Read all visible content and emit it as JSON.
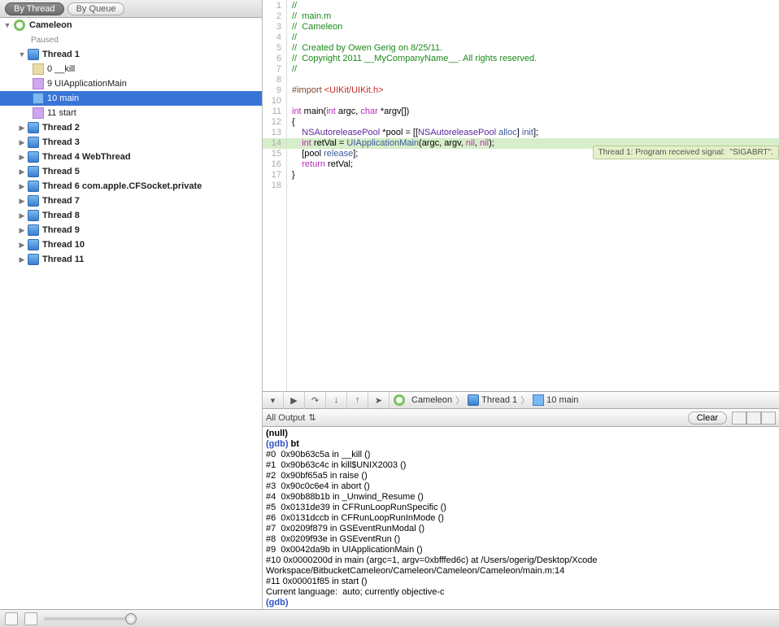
{
  "tabs": {
    "byThread": "By Thread",
    "byQueue": "By Queue"
  },
  "process": {
    "name": "Cameleon",
    "state": "Paused"
  },
  "threads": [
    {
      "label": "Thread 1",
      "open": true,
      "frames": [
        {
          "n": "0",
          "name": "__kill",
          "kind": "kill"
        },
        {
          "n": "9",
          "name": "UIApplicationMain",
          "kind": "lib"
        },
        {
          "n": "10",
          "name": "main",
          "kind": "user",
          "selected": true
        },
        {
          "n": "11",
          "name": "start",
          "kind": "lib"
        }
      ]
    },
    {
      "label": "Thread 2"
    },
    {
      "label": "Thread 3"
    },
    {
      "label": "Thread 4 WebThread"
    },
    {
      "label": "Thread 5"
    },
    {
      "label": "Thread 6 com.apple.CFSocket.private"
    },
    {
      "label": "Thread 7"
    },
    {
      "label": "Thread 8"
    },
    {
      "label": "Thread 9"
    },
    {
      "label": "Thread 10"
    },
    {
      "label": "Thread 11"
    }
  ],
  "code": {
    "hlLine": 14,
    "lines": [
      {
        "t": "//",
        "c": "cm"
      },
      {
        "t": "//  main.m",
        "c": "cm"
      },
      {
        "t": "//  Cameleon",
        "c": "cm"
      },
      {
        "t": "//",
        "c": "cm"
      },
      {
        "t": "//  Created by Owen Gerig on 8/25/11.",
        "c": "cm"
      },
      {
        "t": "//  Copyright 2011 __MyCompanyName__. All rights reserved.",
        "c": "cm"
      },
      {
        "t": "//",
        "c": "cm"
      },
      {
        "t": ""
      },
      {
        "html": "<span class='pp'>#import </span><span class='str'>&lt;UIKit/UIKit.h&gt;</span>"
      },
      {
        "t": ""
      },
      {
        "html": "<span class='kw'>int</span> main(<span class='kw'>int</span> argc, <span class='kw'>char</span> *argv[])"
      },
      {
        "t": "{"
      },
      {
        "html": "    <span class='ty'>NSAutoreleasePool</span> *pool = [[<span class='ty'>NSAutoreleasePool</span> <span class='call'>alloc</span>] <span class='call'>init</span>];"
      },
      {
        "html": "    <span class='kw'>int</span> retVal = <span class='call'>UIApplicationMain</span>(argc, argv, <span class='kw'>nil</span>, <span class='kw'>nil</span>);"
      },
      {
        "html": "    [pool <span class='call'>release</span>];"
      },
      {
        "html": "    <span class='kw'>return</span> retVal;"
      },
      {
        "t": "}"
      },
      {
        "t": ""
      }
    ]
  },
  "signal": "Thread 1: Program received signal:  \"SIGABRT\".",
  "jumpbar": {
    "app": "Cameleon",
    "thread": "Thread 1",
    "frame": "10 main"
  },
  "filter": {
    "label": "All Output",
    "clear": "Clear"
  },
  "console": {
    "lines": [
      {
        "t": "(null)",
        "b": true
      },
      {
        "gdb": "(gdb) ",
        "t": "bt",
        "b": true
      },
      {
        "t": "#0  0x90b63c5a in __kill ()"
      },
      {
        "t": "#1  0x90b63c4c in kill$UNIX2003 ()"
      },
      {
        "t": "#2  0x90bf65a5 in raise ()"
      },
      {
        "t": "#3  0x90c0c6e4 in abort ()"
      },
      {
        "t": "#4  0x90b88b1b in _Unwind_Resume ()"
      },
      {
        "t": "#5  0x0131de39 in CFRunLoopRunSpecific ()"
      },
      {
        "t": "#6  0x0131dccb in CFRunLoopRunInMode ()"
      },
      {
        "t": "#7  0x0209f879 in GSEventRunModal ()"
      },
      {
        "t": "#8  0x0209f93e in GSEventRun ()"
      },
      {
        "t": "#9  0x0042da9b in UIApplicationMain ()"
      },
      {
        "t": "#10 0x0000200d in main (argc=1, argv=0xbfffed6c) at /Users/ogerig/Desktop/Xcode Workspace/BitbucketCameleon/Cameleon/Cameleon/Cameleon/main.m:14"
      },
      {
        "t": "#11 0x00001f85 in start ()"
      },
      {
        "t": "Current language:  auto; currently objective-c"
      },
      {
        "gdb": "(gdb) "
      }
    ]
  }
}
